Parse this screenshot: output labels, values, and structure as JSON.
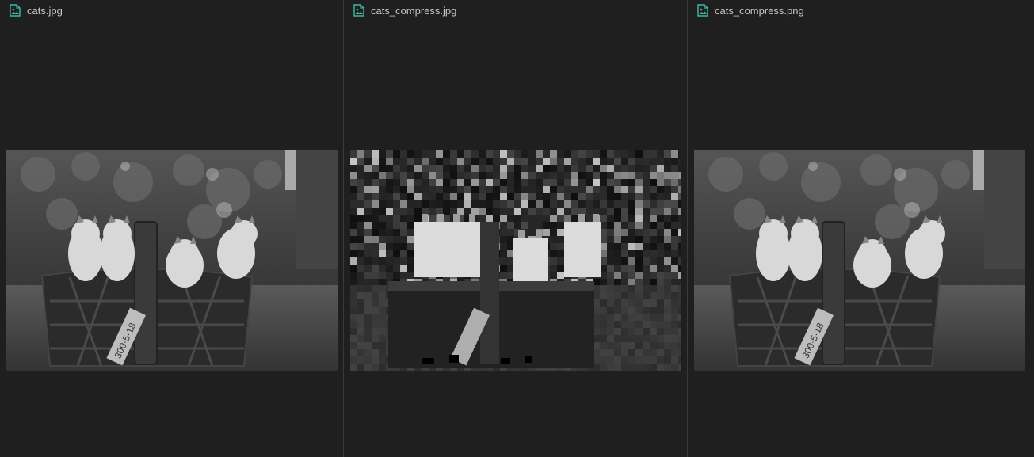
{
  "panes": [
    {
      "filename": "cats.jpg",
      "icon": "image-file-icon",
      "variant": "original"
    },
    {
      "filename": "cats_compress.jpg",
      "icon": "image-file-icon",
      "variant": "compressed"
    },
    {
      "filename": "cats_compress.png",
      "icon": "image-file-icon",
      "variant": "original"
    }
  ],
  "tag_text": "300·5·18",
  "colors": {
    "icon_accent": "#3fb8a0",
    "background": "#1f1f1f",
    "tab_text": "#c8c8c8",
    "divider": "#3a3a3a"
  }
}
